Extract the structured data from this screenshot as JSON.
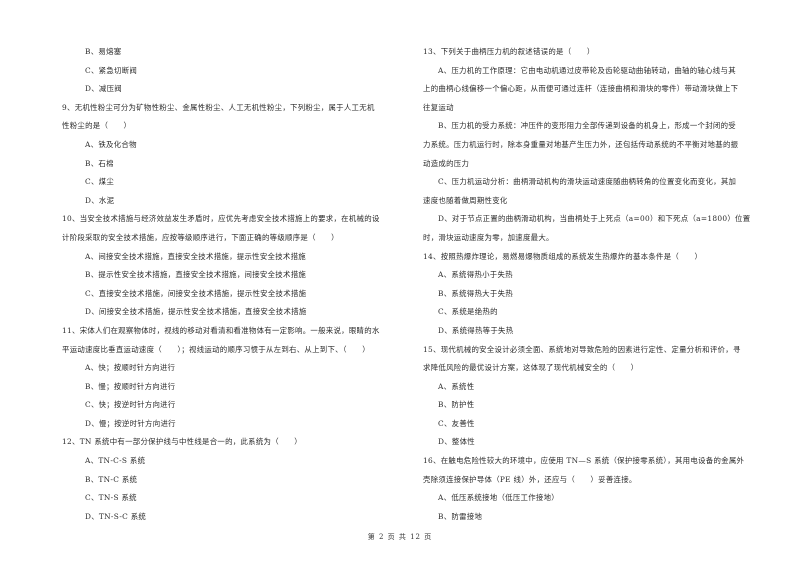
{
  "page": {
    "footer": "第 2 页 共 12 页"
  },
  "left_column": {
    "q8_tail": {
      "options": [
        "B、易熔塞",
        "C、紧急切断阀",
        "D、减压阀"
      ]
    },
    "q9": {
      "stem_lines": [
        "9、无机性粉尘可分为矿物性粉尘、金属性粉尘、人工无机性粉尘，下列粉尘，属于人工无机",
        "性粉尘的是（　　）"
      ],
      "options": [
        "A、铁及化合物",
        "B、石棉",
        "C、煤尘",
        "D、水泥"
      ]
    },
    "q10": {
      "stem_lines": [
        "10、当安全技术措施与经济效益发生矛盾时，应优先考虑安全技术措施上的要求，在机械的设",
        "计阶段采取的安全技术措施，应按等级顺序进行，下面正确的等级顺序是（　　）"
      ],
      "options": [
        "A、间接安全技术措施，直接安全技术措施，提示性安全技术措施",
        "B、提示性安全技术措施，直接安全技术措施，间接安全技术措施",
        "C、直接安全技术措施，间接安全技术措施，提示性安全技术措施",
        "D、间接安全技术措施，提示性安全技术措施，直接安全技术措施"
      ]
    },
    "q11": {
      "stem_lines": [
        "11、宋体人们在观察物体时，视线的移动对看清和看准物体有一定影响。一般来说，眼睛的水",
        "平运动速度比垂直运动速度（　　）；视线运动的顺序习惯于从左到右、从上到下、（　　）"
      ],
      "options": [
        "A、快；按顺时针方向进行",
        "B、慢；按顺时针方向进行",
        "C、快；按逆时针方向进行",
        "D、慢；按逆时针方向进行"
      ]
    },
    "q12": {
      "stem_lines": [
        "12、TN 系统中有一部分保护线与中性线是合一的，此系统为（　　）"
      ],
      "options": [
        "A、TN-C-S 系统",
        "B、TN-C 系统",
        "C、TN-S 系统",
        "D、TN-S-C 系统"
      ]
    }
  },
  "right_column": {
    "q13": {
      "stem_lines": [
        "13、下列关于曲柄压力机的叙述错误的是（　　）"
      ],
      "options": [
        [
          "A、压力机的工作原理：它由电动机通过皮带轮及齿轮驱动曲轴转动，曲轴的轴心线与其",
          "上的曲柄心线偏移一个偏心距，从而便可通过连杆（连接曲柄和滑块的零件）带动滑块做上下",
          "往复运动"
        ],
        [
          "B、压力机的受力系统：冲压件的变形阻力全部传递到设备的机身上，形成一个封闭的受",
          "力系统。压力机运行时，除本身重量对地基产生压力外，还包括传动系统的不平衡对地基的振",
          "动造成的压力"
        ],
        [
          "C、压力机运动分析：曲柄滑动机构的滑块运动速度随曲柄转角的位置变化而变化，其加",
          "速度也随着做周期性变化"
        ],
        [
          "D、对于节点正置的曲柄滑动机构，当曲柄处于上死点（a=00）和下死点（a=1800）位置",
          "时，滑块运动速度为零，加速度最大。"
        ]
      ]
    },
    "q14": {
      "stem_lines": [
        "14、按照热爆炸理论，易燃易爆物质组成的系统发生热爆炸的基本条件是（　　）"
      ],
      "options": [
        "A、系统得热小于失热",
        "B、系统得热大于失热",
        "C、系统是绝热的",
        "D、系统得热等于失热"
      ]
    },
    "q15": {
      "stem_lines": [
        "15、现代机械的安全设计必须全面、系统地对导致危险的因素进行定性、定量分析和评价，寻",
        "求降低风险的最优设计方案，这体现了现代机械安全的（　　）"
      ],
      "options": [
        "A、系统性",
        "B、防护性",
        "C、友善性",
        "D、整体性"
      ]
    },
    "q16": {
      "stem_lines": [
        "16、在触电危险性较大的环境中，应使用 TN—S 系统（保护接零系统），其用电设备的金属外",
        "壳除须连接保护导体（PE 线）外，还应与（　　）妥善连接。"
      ],
      "options": [
        "A、低压系统接地（低压工作接地）",
        "B、防雷接地"
      ]
    }
  }
}
